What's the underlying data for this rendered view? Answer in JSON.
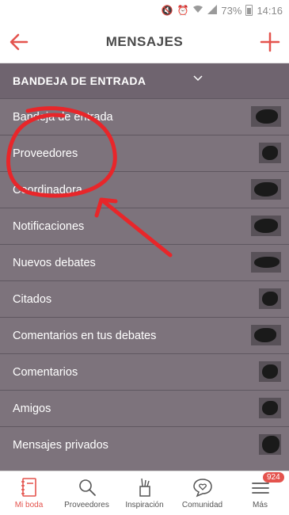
{
  "status_bar": {
    "battery_percent": "73%",
    "time": "14:16",
    "icons": [
      "mute-icon",
      "alarm-icon",
      "wifi-icon",
      "signal-icon",
      "battery-icon"
    ]
  },
  "header": {
    "title": "MENSAJES",
    "back_icon": "arrow-left-icon",
    "add_icon": "plus-icon"
  },
  "section": {
    "title": "BANDEJA DE ENTRADA",
    "chevron_icon": "chevron-down-icon"
  },
  "folders": [
    {
      "label": "Bandeja de entrada"
    },
    {
      "label": "Proveedores"
    },
    {
      "label": "Coordinadora"
    },
    {
      "label": "Notificaciones"
    },
    {
      "label": "Nuevos debates"
    },
    {
      "label": "Citados"
    },
    {
      "label": "Comentarios en tus debates"
    },
    {
      "label": "Comentarios"
    },
    {
      "label": "Amigos"
    },
    {
      "label": "Mensajes privados"
    }
  ],
  "bottom_nav": [
    {
      "label": "Mi boda",
      "icon": "notebook-icon",
      "active": true
    },
    {
      "label": "Proveedores",
      "icon": "search-icon"
    },
    {
      "label": "Inspiración",
      "icon": "pencil-cup-icon"
    },
    {
      "label": "Comunidad",
      "icon": "chat-heart-icon"
    },
    {
      "label": "Más",
      "icon": "menu-icon",
      "badge": "924"
    }
  ],
  "colors": {
    "accent": "#e4534d",
    "section_bg": "#6f646f",
    "list_bg": "#7d737c",
    "annotation": "#e8262a"
  }
}
